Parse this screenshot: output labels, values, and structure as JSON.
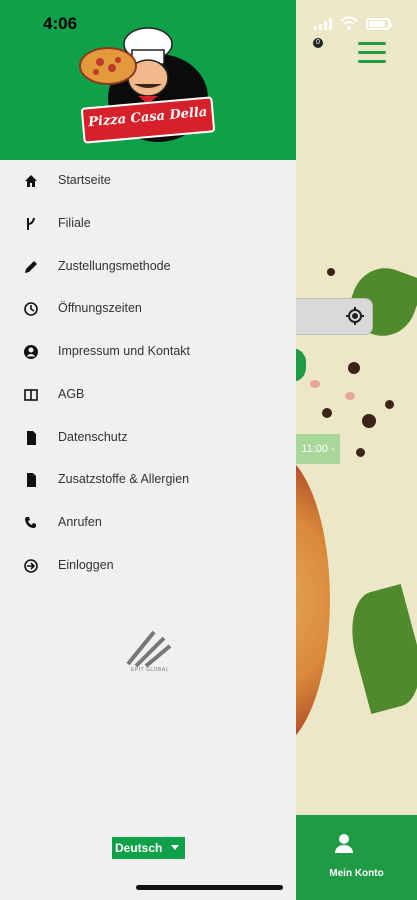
{
  "status_bar": {
    "time": "4:06"
  },
  "brand": {
    "logo_text": "Pizza Casa Della",
    "footer_mark": "EPIT GLOBAL"
  },
  "menu": {
    "items": [
      {
        "label": "Startseite",
        "icon": "home-icon"
      },
      {
        "label": "Filiale",
        "icon": "branch-icon"
      },
      {
        "label": "Zustellungsmethode",
        "icon": "pencil-icon"
      },
      {
        "label": "Öffnungszeiten",
        "icon": "clock-icon"
      },
      {
        "label": "Impressum und Kontakt",
        "icon": "account-circle-icon"
      },
      {
        "label": "AGB",
        "icon": "book-icon"
      },
      {
        "label": "Datenschutz",
        "icon": "document-icon"
      },
      {
        "label": "Zusatzstoffe & Allergien",
        "icon": "document-icon"
      },
      {
        "label": "Anrufen",
        "icon": "phone-icon"
      },
      {
        "label": "Einloggen",
        "icon": "login-icon"
      }
    ]
  },
  "language": {
    "selected": "Deutsch"
  },
  "background": {
    "time_badge": "11:00 -",
    "bottom_nav_label": "Mein Konto",
    "cart_count": "0"
  },
  "colors": {
    "primary": "#0fa14a",
    "drawer_bg": "#f0f0f0",
    "text": "#333333"
  }
}
